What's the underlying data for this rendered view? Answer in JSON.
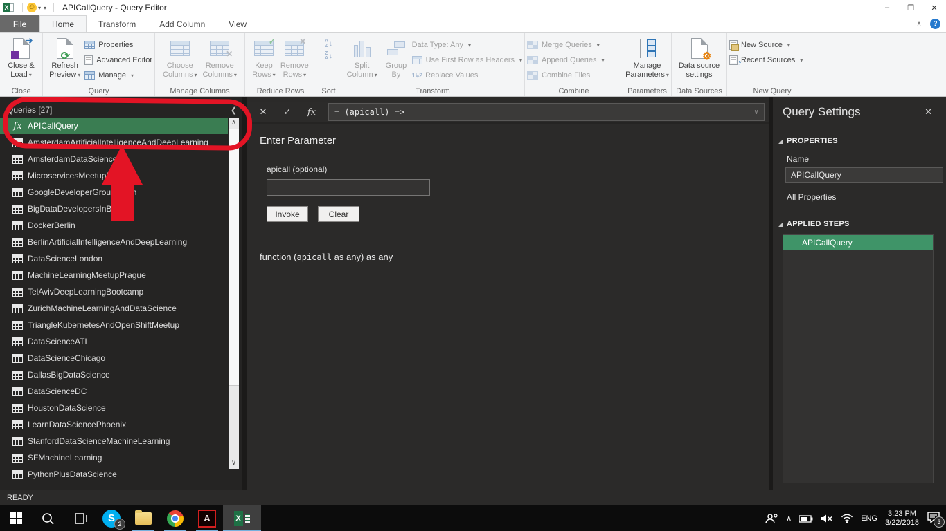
{
  "colors": {
    "selection_green": "#3a7d52",
    "step_green": "#3f9468",
    "annotation_red": "#e31425",
    "excel_green": "#1e7145",
    "taskbar_underline": "#76b0dd"
  },
  "icons": {
    "caret": "▾",
    "cancel": "✕",
    "check": "✓",
    "fx": "fx",
    "chevron_left": "❮",
    "chevron_up": "∧",
    "chevron_down": "∨",
    "formula_caret": "∨",
    "minimize": "–",
    "restore": "❐",
    "close": "✕",
    "help": "?",
    "smiley": "☺",
    "qat_caret": "▾",
    "refresh": "⟳",
    "gear": "⚙",
    "clock": "◔",
    "arrow_small": "➜",
    "az_a": "A",
    "az_z": "Z",
    "down_arrow": "↓",
    "one_two": "1↳2",
    "ribbon_collapse": "∧"
  },
  "window": {
    "title": "APICallQuery - Query Editor"
  },
  "tabs": {
    "file": "File",
    "items": [
      "Home",
      "Transform",
      "Add Column",
      "View"
    ]
  },
  "ribbon": {
    "close_group": {
      "label": "Close",
      "close_load": {
        "l1": "Close &",
        "l2": "Load"
      }
    },
    "query_group": {
      "label": "Query",
      "refresh": {
        "l1": "Refresh",
        "l2": "Preview"
      },
      "properties": "Properties",
      "advanced_editor": "Advanced Editor",
      "manage": "Manage"
    },
    "manage_columns_group": {
      "label": "Manage Columns",
      "choose": {
        "l1": "Choose",
        "l2": "Columns"
      },
      "remove": {
        "l1": "Remove",
        "l2": "Columns"
      }
    },
    "reduce_rows_group": {
      "label": "Reduce Rows",
      "keep": {
        "l1": "Keep",
        "l2": "Rows"
      },
      "remove": {
        "l1": "Remove",
        "l2": "Rows"
      }
    },
    "sort_group": {
      "label": "Sort"
    },
    "transform_group": {
      "label": "Transform",
      "split": {
        "l1": "Split",
        "l2": "Column"
      },
      "group_by": {
        "l1": "Group",
        "l2": "By"
      },
      "data_type": "Data Type: Any",
      "first_row": "Use First Row as Headers",
      "replace_values": "Replace Values"
    },
    "combine_group": {
      "label": "Combine",
      "merge": "Merge Queries",
      "append": "Append Queries",
      "combine_files": "Combine Files"
    },
    "parameters_group": {
      "label": "Parameters",
      "manage_parameters": {
        "l1": "Manage",
        "l2": "Parameters"
      }
    },
    "data_sources_group": {
      "label": "Data Sources",
      "settings": {
        "l1": "Data source",
        "l2": "settings"
      }
    },
    "new_query_group": {
      "label": "New Query",
      "new_source": "New Source",
      "recent_sources": "Recent Sources"
    }
  },
  "queries": {
    "header": "Queries [27]",
    "items": [
      {
        "name": "APICallQuery",
        "icon": "fx",
        "selected": true
      },
      {
        "name": "AmsterdamArtificialIntelligenceAndDeepLearning",
        "icon": "table"
      },
      {
        "name": "AmsterdamDataScience",
        "icon": "table"
      },
      {
        "name": "MicroservicesMeetupBerlin",
        "icon": "table"
      },
      {
        "name": "GoogleDeveloperGroupBerlin",
        "icon": "table"
      },
      {
        "name": "BigDataDevelopersInBerlin",
        "icon": "table"
      },
      {
        "name": "DockerBerlin",
        "icon": "table"
      },
      {
        "name": "BerlinArtificialIntelligenceAndDeepLearning",
        "icon": "table"
      },
      {
        "name": "DataScienceLondon",
        "icon": "table"
      },
      {
        "name": "MachineLearningMeetupPrague",
        "icon": "table"
      },
      {
        "name": "TelAvivDeepLearningBootcamp",
        "icon": "table"
      },
      {
        "name": "ZurichMachineLearningAndDataScience",
        "icon": "table"
      },
      {
        "name": "TriangleKubernetesAndOpenShiftMeetup",
        "icon": "table"
      },
      {
        "name": "DataScienceATL",
        "icon": "table"
      },
      {
        "name": "DataScienceChicago",
        "icon": "table"
      },
      {
        "name": "DallasBigDataScience",
        "icon": "table"
      },
      {
        "name": "DataScienceDC",
        "icon": "table"
      },
      {
        "name": "HoustonDataScience",
        "icon": "table"
      },
      {
        "name": "LearnDataSciencePhoenix",
        "icon": "table"
      },
      {
        "name": "StanfordDataScienceMachineLearning",
        "icon": "table"
      },
      {
        "name": "SFMachineLearning",
        "icon": "table"
      },
      {
        "name": "PythonPlusDataScience",
        "icon": "table"
      }
    ]
  },
  "formula": {
    "text": "= (apicall) =>"
  },
  "parameter": {
    "heading": "Enter Parameter",
    "label": "apicall (optional)",
    "value": "",
    "invoke": "Invoke",
    "clear": "Clear",
    "fn_part1": "function (",
    "fn_mono": "apicall",
    "fn_part2": " as any) as any"
  },
  "settings": {
    "title": "Query Settings",
    "properties_header": "PROPERTIES",
    "name_label": "Name",
    "name_value": "APICallQuery",
    "all_properties": "All Properties",
    "steps_header": "APPLIED STEPS",
    "steps": [
      "APICallQuery"
    ]
  },
  "status": {
    "text": "READY"
  },
  "taskbar": {
    "skype_badge": "2",
    "notification_badge": "3",
    "language": "ENG",
    "time": "3:23 PM",
    "date": "3/22/2018"
  }
}
